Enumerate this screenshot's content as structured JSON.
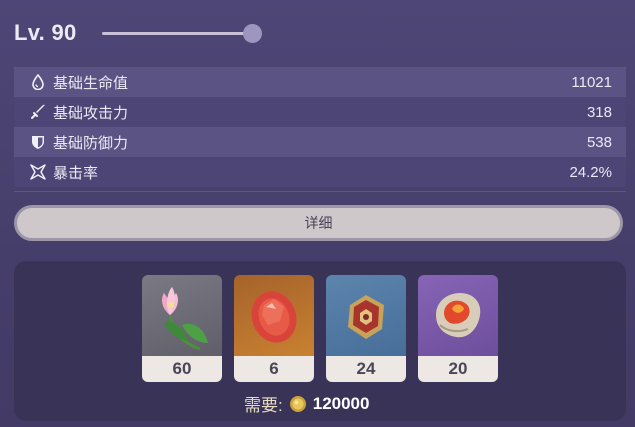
{
  "level": {
    "label": "Lv. 90",
    "progress": 1.0
  },
  "stats": [
    {
      "icon": "water-drop-icon",
      "name": "基础生命值",
      "value": "11021"
    },
    {
      "icon": "sword-icon",
      "name": "基础攻击力",
      "value": "318"
    },
    {
      "icon": "shield-icon",
      "name": "基础防御力",
      "value": "538"
    },
    {
      "icon": "crit-star-icon",
      "name": "暴击率",
      "value": "24.2%"
    }
  ],
  "detail_button": {
    "label": "详细"
  },
  "materials": [
    {
      "name": "lotus-flower-item",
      "count": "60",
      "rarity_color": "#6e6d78"
    },
    {
      "name": "red-gem-item",
      "count": "6",
      "rarity_color": "#b8722c"
    },
    {
      "name": "ornate-emblem-item",
      "count": "24",
      "rarity_color": "#4f78a3"
    },
    {
      "name": "fire-relic-item",
      "count": "20",
      "rarity_color": "#7a5aa8"
    }
  ],
  "cost": {
    "label": "需要:",
    "icon": "mora-coin-icon",
    "value": "120000"
  }
}
